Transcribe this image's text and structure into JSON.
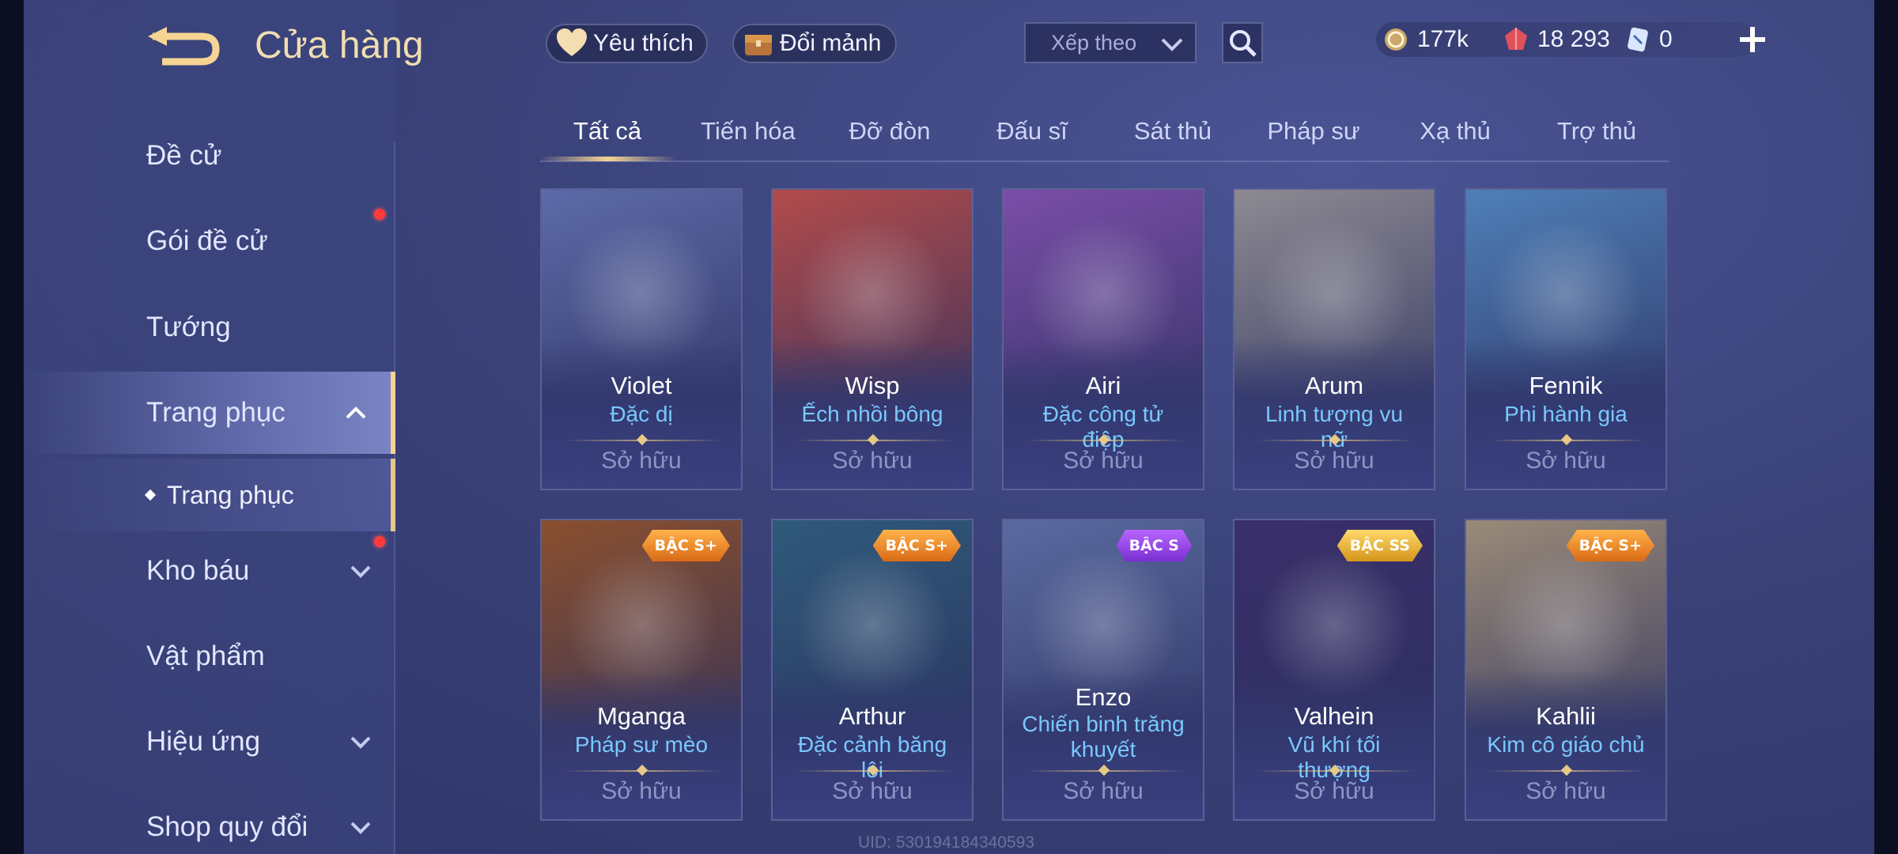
{
  "header": {
    "title": "Cửa hàng",
    "favorites_label": "Yêu thích",
    "exchange_label": "Đổi mảnh",
    "sort_label": "Xếp theo"
  },
  "currencies": {
    "gold": "177k",
    "quan_huy": "18 293",
    "tickets": "0"
  },
  "sidebar": {
    "items": [
      {
        "label": "Đề cử"
      },
      {
        "label": "Gói đề cử"
      },
      {
        "label": "Tướng"
      },
      {
        "label": "Trang phục"
      },
      {
        "label": "Trang phục"
      },
      {
        "label": "Kho báu"
      },
      {
        "label": "Vật phẩm"
      },
      {
        "label": "Hiệu ứng"
      },
      {
        "label": "Shop quy đổi"
      }
    ]
  },
  "tabs": [
    "Tất cả",
    "Tiến hóa",
    "Đỡ đòn",
    "Đấu sĩ",
    "Sát thủ",
    "Pháp sư",
    "Xạ thủ",
    "Trợ thủ"
  ],
  "cards": [
    {
      "hero": "Violet",
      "skin": "Đặc dị",
      "status": "Sở hữu",
      "badge": "",
      "color": "#5d6aa8"
    },
    {
      "hero": "Wisp",
      "skin": "Ếch nhồi bông",
      "status": "Sở hữu",
      "badge": "",
      "color": "#b24b4b"
    },
    {
      "hero": "Airi",
      "skin": "Đặc công tử điệp",
      "status": "Sở hữu",
      "badge": "",
      "color": "#7a4ea8"
    },
    {
      "hero": "Arum",
      "skin": "Linh tượng vu nữ",
      "status": "Sở hữu",
      "badge": "",
      "color": "#8d8a92"
    },
    {
      "hero": "Fennik",
      "skin": "Phi hành gia",
      "status": "Sở hữu",
      "badge": "",
      "color": "#4f7fb8"
    },
    {
      "hero": "Mganga",
      "skin": "Pháp sư mèo",
      "status": "Sở hữu",
      "badge": "BẬC S+",
      "color": "#8a4f2e"
    },
    {
      "hero": "Arthur",
      "skin": "Đặc cảnh băng lôi",
      "status": "Sở hữu",
      "badge": "BẬC S+",
      "color": "#2f5a7a"
    },
    {
      "hero": "Enzo",
      "skin": "Chiến binh trăng khuyết",
      "status": "Sở hữu",
      "badge": "BẬC S",
      "color": "#5a6aa0"
    },
    {
      "hero": "Valhein",
      "skin": "Vũ khí tối thượng",
      "status": "Sở hữu",
      "badge": "BẬC SS",
      "color": "#3a2f6a"
    },
    {
      "hero": "Kahlii",
      "skin": "Kim cô giáo chủ",
      "status": "Sở hữu",
      "badge": "BẬC S+",
      "color": "#9a8a78"
    }
  ],
  "footer": {
    "uid": "UID: 530194184340593"
  },
  "colors": {
    "accent": "#f5d593",
    "skin_text": "#79c8ff",
    "notify": "#ff3b3b"
  }
}
